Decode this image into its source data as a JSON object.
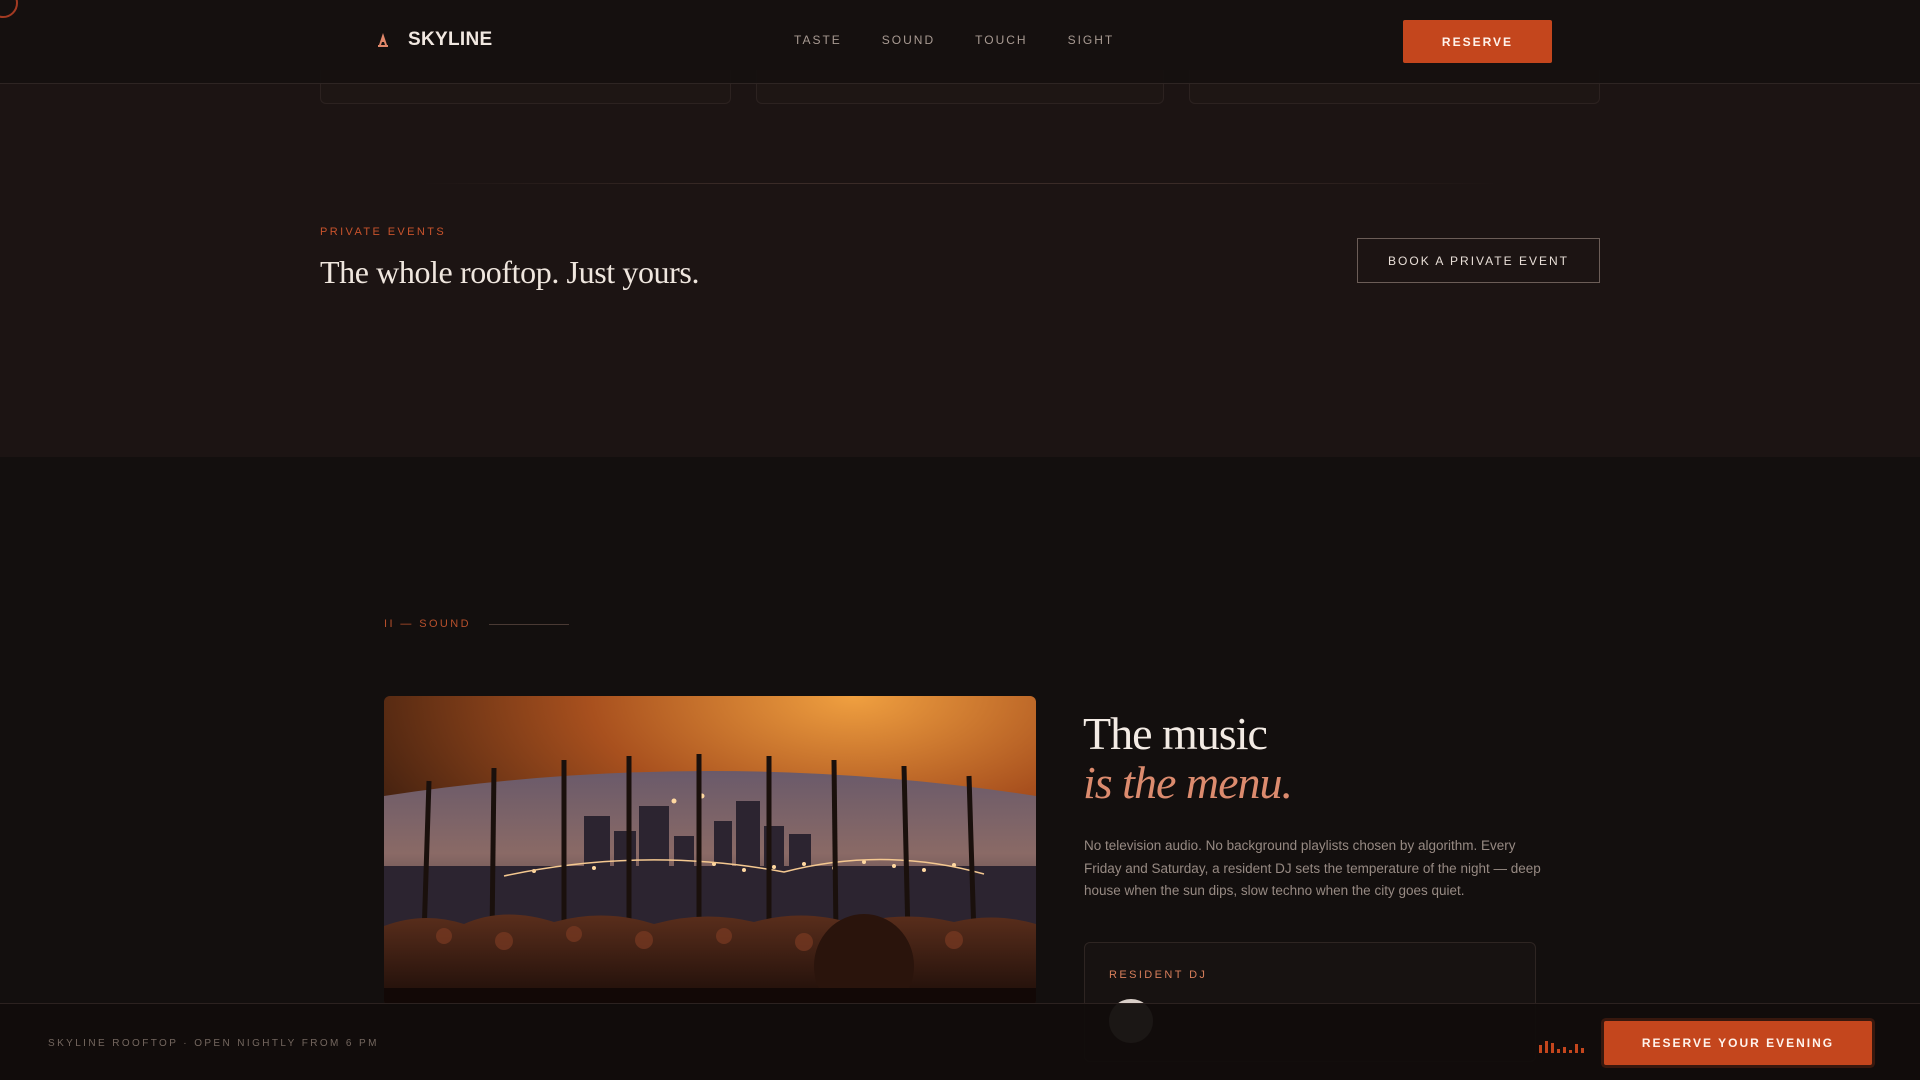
{
  "brand": {
    "name": "SKYLINE",
    "icon": "tower-icon"
  },
  "nav": {
    "items": [
      "TASTE",
      "SOUND",
      "TOUCH",
      "SIGHT"
    ]
  },
  "header": {
    "reserve_label": "RESERVE"
  },
  "private_events": {
    "eyebrow": "PRIVATE EVENTS",
    "title": "The whole rooftop. Just yours.",
    "button_label": "BOOK A PRIVATE EVENT"
  },
  "sound": {
    "eyebrow": "II — SOUND",
    "photo": "rooftop-dj-crowd-photo",
    "title_line1": "The music",
    "title_line2": "is the menu.",
    "body": "No television audio. No background playlists chosen by algorithm. Every Friday and Saturday, a resident DJ sets the temperature of the night — deep house when the sun dips, slow techno when the city goes quiet.",
    "dj_card_label": "RESIDENT DJ"
  },
  "footer": {
    "info": "SKYLINE ROOFTOP · OPEN NIGHTLY FROM 6 PM",
    "eq_icon": "equalizer-icon",
    "cta_label": "RESERVE YOUR EVENING"
  },
  "colors": {
    "accent": "#c4461d",
    "accent_soft": "#dc8b6e",
    "background": "#130f0e",
    "upper_background": "#1c1413"
  }
}
